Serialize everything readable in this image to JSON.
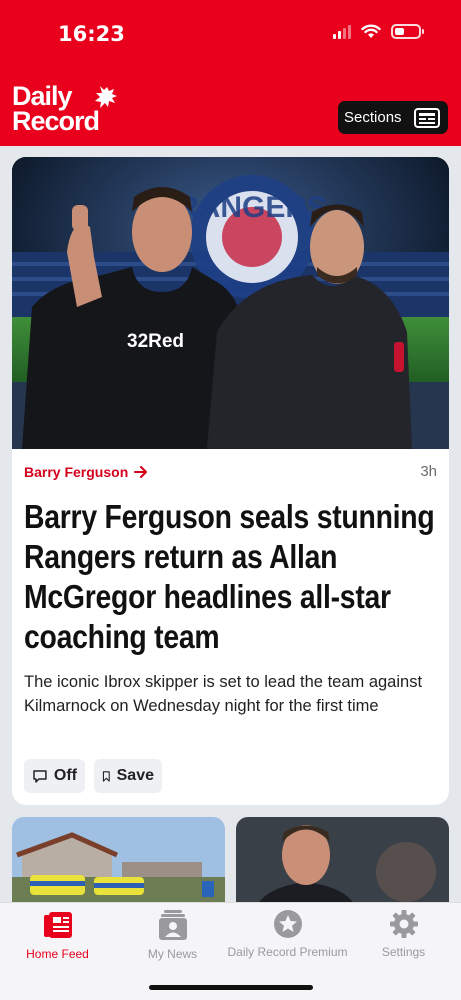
{
  "status_bar": {
    "time": "16:23"
  },
  "header": {
    "logo_line1": "Daily",
    "logo_line2": "Record",
    "sections_label": "Sections"
  },
  "article": {
    "kicker": "Barry Ferguson",
    "time_ago": "3h",
    "headline": "Barry Ferguson seals stunning Rangers return as Allan McGregor headlines all-star coaching team",
    "standfirst": "The iconic Ibrox skipper is set to lead the team against Kilmarnock on Wednesday night for the first time",
    "comments_label": "Off",
    "save_label": "Save",
    "hero_texts": {
      "sponsor": "32Red",
      "sign": "RANGERS"
    }
  },
  "tabs": [
    {
      "label": "Home Feed",
      "icon": "newspaper-icon",
      "active": true
    },
    {
      "label": "My News",
      "icon": "my-news-icon",
      "active": false
    },
    {
      "label": "Daily Record Premium",
      "icon": "star-icon",
      "active": false
    },
    {
      "label": "Settings",
      "icon": "gear-icon",
      "active": false
    }
  ],
  "colors": {
    "brand_red": "#e8001c",
    "kicker_red": "#d3001b",
    "tab_inactive": "#9a9a9e"
  }
}
